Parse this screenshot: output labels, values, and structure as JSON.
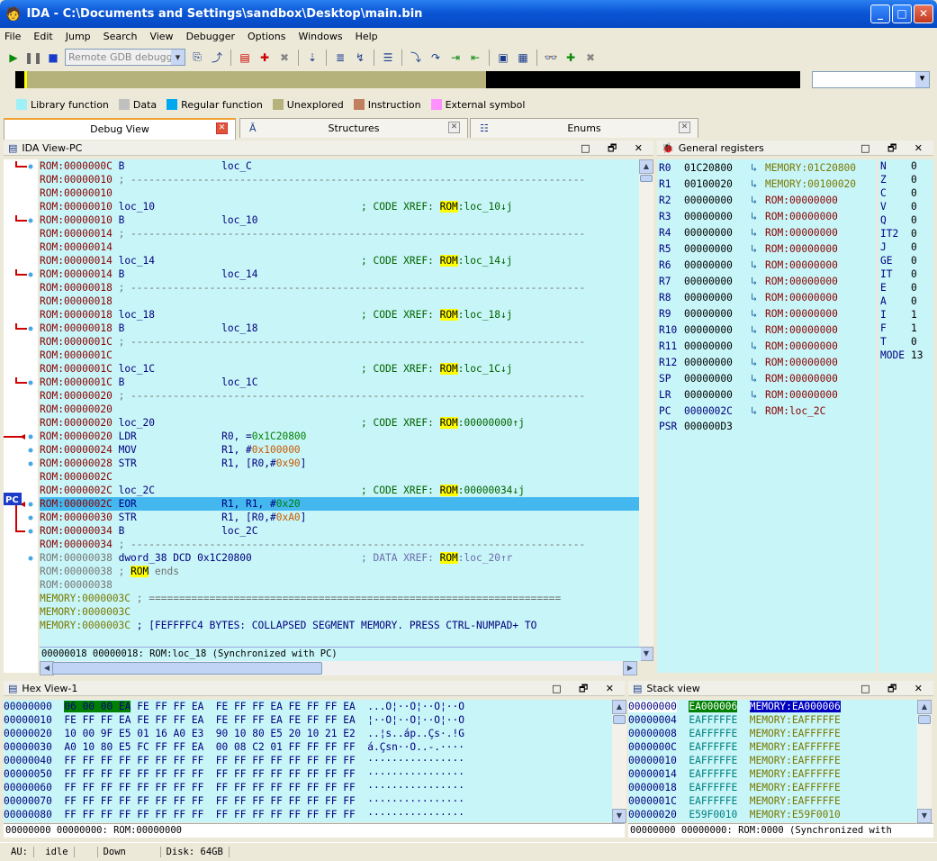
{
  "window": {
    "title": "IDA - C:\\Documents and Settings\\sandbox\\Desktop\\main.bin"
  },
  "menu": [
    "File",
    "Edit",
    "Jump",
    "Search",
    "View",
    "Debugger",
    "Options",
    "Windows",
    "Help"
  ],
  "toolbar": {
    "debugger_select": "Remote GDB debugger"
  },
  "legend": [
    {
      "label": "Library function",
      "color": "#a0f0f8"
    },
    {
      "label": "Data",
      "color": "#c0c0c0"
    },
    {
      "label": "Regular function",
      "color": "#00a8f0"
    },
    {
      "label": "Unexplored",
      "color": "#b5b37b"
    },
    {
      "label": "Instruction",
      "color": "#c08060"
    },
    {
      "label": "External symbol",
      "color": "#ff90ff"
    }
  ],
  "tabs": [
    "Debug View",
    "Structures",
    "Enums"
  ],
  "ida_view": {
    "title": "IDA View-PC",
    "status": "00000018 00000018: ROM:loc_18 (Synchronized with PC)"
  },
  "registers": {
    "title": "General registers",
    "rows": [
      {
        "name": "R0",
        "value": "01C20800",
        "target": "MEMORY:01C20800",
        "mem": true
      },
      {
        "name": "R1",
        "value": "00100020",
        "target": "MEMORY:00100020",
        "mem": true
      },
      {
        "name": "R2",
        "value": "00000000",
        "target": "ROM:00000000"
      },
      {
        "name": "R3",
        "value": "00000000",
        "target": "ROM:00000000"
      },
      {
        "name": "R4",
        "value": "00000000",
        "target": "ROM:00000000"
      },
      {
        "name": "R5",
        "value": "00000000",
        "target": "ROM:00000000"
      },
      {
        "name": "R6",
        "value": "00000000",
        "target": "ROM:00000000"
      },
      {
        "name": "R7",
        "value": "00000000",
        "target": "ROM:00000000"
      },
      {
        "name": "R8",
        "value": "00000000",
        "target": "ROM:00000000"
      },
      {
        "name": "R9",
        "value": "00000000",
        "target": "ROM:00000000"
      },
      {
        "name": "R10",
        "value": "00000000",
        "target": "ROM:00000000"
      },
      {
        "name": "R11",
        "value": "00000000",
        "target": "ROM:00000000"
      },
      {
        "name": "R12",
        "value": "00000000",
        "target": "ROM:00000000"
      },
      {
        "name": "SP",
        "value": "00000000",
        "target": "ROM:00000000"
      },
      {
        "name": "LR",
        "value": "00000000",
        "target": "ROM:00000000"
      },
      {
        "name": "PC",
        "value": "0000002C",
        "target": "ROM:loc_2C",
        "changed": true
      },
      {
        "name": "PSR",
        "value": "000000D3",
        "target": ""
      }
    ],
    "flags": [
      {
        "name": "N",
        "value": "0"
      },
      {
        "name": "Z",
        "value": "0"
      },
      {
        "name": "C",
        "value": "0"
      },
      {
        "name": "V",
        "value": "0"
      },
      {
        "name": "Q",
        "value": "0"
      },
      {
        "name": "IT2",
        "value": "0"
      },
      {
        "name": "J",
        "value": "0"
      },
      {
        "name": "GE",
        "value": "0"
      },
      {
        "name": "IT",
        "value": "0"
      },
      {
        "name": "E",
        "value": "0"
      },
      {
        "name": "A",
        "value": "0"
      },
      {
        "name": "I",
        "value": "1"
      },
      {
        "name": "F",
        "value": "1"
      },
      {
        "name": "T",
        "value": "0"
      },
      {
        "name": "MODE",
        "value": "13"
      }
    ]
  },
  "hex_view": {
    "title": "Hex View-1",
    "status": "00000000 00000000: ROM:00000000",
    "rows": [
      {
        "addr": "00000000",
        "b1": "06 00 00 EA",
        "b2": "FE FF FF EA",
        "b3": "FE FF FF EA",
        "b4": "FE FF FF EA",
        "ascii": "...O¦··O¦··O¦··O"
      },
      {
        "addr": "00000010",
        "b1": "FE FF FF EA",
        "b2": "FE FF FF EA",
        "b3": "FE FF FF EA",
        "b4": "FE FF FF EA",
        "ascii": "¦··O¦··O¦··O¦··O"
      },
      {
        "addr": "00000020",
        "b1": "10 00 9F E5",
        "b2": "01 16 A0 E3",
        "b3": "90 10 80 E5",
        "b4": "20 10 21 E2",
        "ascii": "..¦s..áp..Çs·.!G"
      },
      {
        "addr": "00000030",
        "b1": "A0 10 80 E5",
        "b2": "FC FF FF EA",
        "b3": "00 08 C2 01",
        "b4": "FF FF FF FF",
        "ascii": "á.Çsn··O..-.····"
      },
      {
        "addr": "00000040",
        "b1": "FF FF FF FF",
        "b2": "FF FF FF FF",
        "b3": "FF FF FF FF",
        "b4": "FF FF FF FF",
        "ascii": "················"
      },
      {
        "addr": "00000050",
        "b1": "FF FF FF FF",
        "b2": "FF FF FF FF",
        "b3": "FF FF FF FF",
        "b4": "FF FF FF FF",
        "ascii": "················"
      },
      {
        "addr": "00000060",
        "b1": "FF FF FF FF",
        "b2": "FF FF FF FF",
        "b3": "FF FF FF FF",
        "b4": "FF FF FF FF",
        "ascii": "················"
      },
      {
        "addr": "00000070",
        "b1": "FF FF FF FF",
        "b2": "FF FF FF FF",
        "b3": "FF FF FF FF",
        "b4": "FF FF FF FF",
        "ascii": "················"
      },
      {
        "addr": "00000080",
        "b1": "FF FF FF FF",
        "b2": "FF FF FF FF",
        "b3": "FF FF FF FF",
        "b4": "FF FF FF FF",
        "ascii": "················"
      }
    ]
  },
  "stack_view": {
    "title": "Stack view",
    "status": "00000000 00000000: ROM:0000 (Synchronized with",
    "rows": [
      {
        "addr": "00000000",
        "value": "EA000006",
        "target": "MEMORY:EA000006"
      },
      {
        "addr": "00000004",
        "value": "EAFFFFFE",
        "target": "MEMORY:EAFFFFFE"
      },
      {
        "addr": "00000008",
        "value": "EAFFFFFE",
        "target": "MEMORY:EAFFFFFE"
      },
      {
        "addr": "0000000C",
        "value": "EAFFFFFE",
        "target": "MEMORY:EAFFFFFE"
      },
      {
        "addr": "00000010",
        "value": "EAFFFFFE",
        "target": "MEMORY:EAFFFFFE"
      },
      {
        "addr": "00000014",
        "value": "EAFFFFFE",
        "target": "MEMORY:EAFFFFFE"
      },
      {
        "addr": "00000018",
        "value": "EAFFFFFE",
        "target": "MEMORY:EAFFFFFE"
      },
      {
        "addr": "0000001C",
        "value": "EAFFFFFE",
        "target": "MEMORY:EAFFFFFE"
      },
      {
        "addr": "00000020",
        "value": "E59F0010",
        "target": "MEMORY:E59F0010"
      }
    ]
  },
  "statusbar": {
    "au_label": "AU:",
    "au_state": "idle",
    "direction": "Down",
    "disk": "Disk: 64GB"
  },
  "pc_badge": "PC"
}
